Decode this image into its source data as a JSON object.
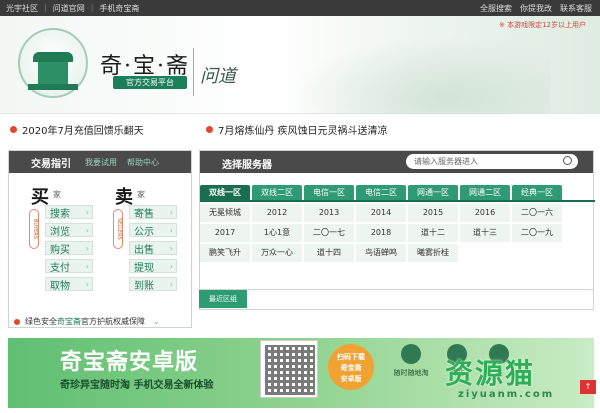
{
  "topbar": {
    "left": [
      "光宇社区",
      "问道官网",
      "手机奇宝斋"
    ],
    "right": [
      "全服搜索",
      "你提我改",
      "联系客服"
    ]
  },
  "header": {
    "logo_text": "奇·宝·斋",
    "logo_sub": "官方交易平台",
    "callig": "问道",
    "age_note": "※ 本游戏限定12岁以上用户"
  },
  "news": [
    "2020年7月充值回馈乐翻天",
    "7月熔炼仙丹 疾风蚀日元灵祸斗送清凉"
  ],
  "guide": {
    "title": "交易指引",
    "link1": "我要试用",
    "link2": "帮助中心",
    "buy_big": "买",
    "buy_small": "家",
    "buy_vert": "BUYERS",
    "sell_big": "卖",
    "sell_small": "家",
    "sell_vert": "SELLERS",
    "buy_items": [
      "搜索",
      "浏览",
      "购买",
      "支付",
      "取物"
    ],
    "sell_items": [
      "寄售",
      "公示",
      "出售",
      "提现",
      "到账"
    ],
    "foot": "绿色安全",
    "foot_hl": "奇宝斋",
    "foot_end": "官方护航权威保障"
  },
  "server": {
    "title": "选择服务器",
    "search_placeholder": "请输入服务器进入",
    "tabs": [
      "双线一区",
      "双线二区",
      "电信一区",
      "电信二区",
      "网通一区",
      "网通二区",
      "经典一区"
    ],
    "cells": [
      "无冕倾城",
      "2012",
      "2013",
      "2014",
      "2015",
      "2016",
      "二〇一六",
      "2017",
      "1心1意",
      "二〇一七",
      "2018",
      "道十二",
      "道十三",
      "二〇一九",
      "鹏笑飞升",
      "万众一心",
      "道十四",
      "鸟语蝉鸣",
      "曦雾折桂"
    ],
    "recent_tab": "最近区组"
  },
  "banner": {
    "title": "奇宝斋安卓版",
    "sub": "奇珍异宝随时淘 手机交易全新体验",
    "badge": "扫码下载\n奇宝斋\n安卓版",
    "features": [
      "随时随地淘",
      "网站",
      "钱"
    ],
    "watermark": "资源猫",
    "watermark_sub": "ziyuanm.com",
    "scroll": "↑"
  },
  "colors": {
    "accent": "#2e9b73",
    "accent_dark": "#1a6e50",
    "news_dot": "#e04a2a",
    "header_bar": "#4a4a4a"
  }
}
